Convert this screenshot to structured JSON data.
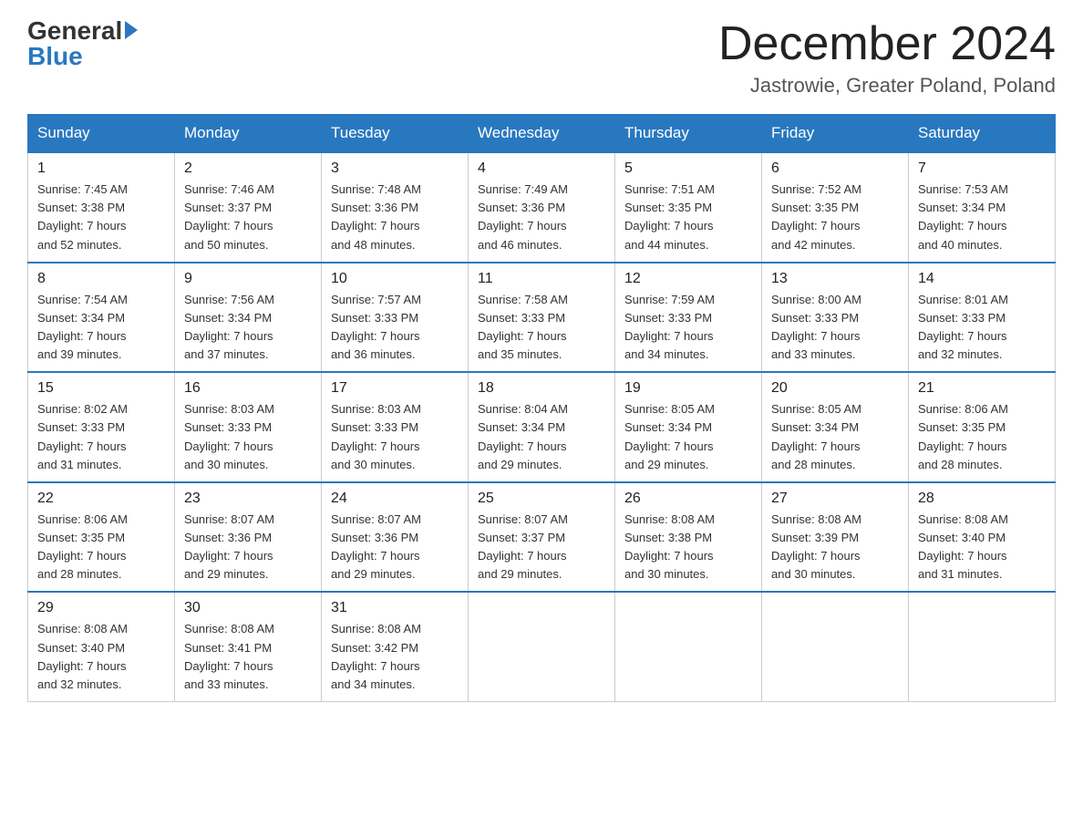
{
  "header": {
    "logo_general": "General",
    "logo_blue": "Blue",
    "month_title": "December 2024",
    "location": "Jastrowie, Greater Poland, Poland"
  },
  "weekdays": [
    "Sunday",
    "Monday",
    "Tuesday",
    "Wednesday",
    "Thursday",
    "Friday",
    "Saturday"
  ],
  "weeks": [
    [
      {
        "day": "1",
        "sunrise": "7:45 AM",
        "sunset": "3:38 PM",
        "daylight": "7 hours and 52 minutes."
      },
      {
        "day": "2",
        "sunrise": "7:46 AM",
        "sunset": "3:37 PM",
        "daylight": "7 hours and 50 minutes."
      },
      {
        "day": "3",
        "sunrise": "7:48 AM",
        "sunset": "3:36 PM",
        "daylight": "7 hours and 48 minutes."
      },
      {
        "day": "4",
        "sunrise": "7:49 AM",
        "sunset": "3:36 PM",
        "daylight": "7 hours and 46 minutes."
      },
      {
        "day": "5",
        "sunrise": "7:51 AM",
        "sunset": "3:35 PM",
        "daylight": "7 hours and 44 minutes."
      },
      {
        "day": "6",
        "sunrise": "7:52 AM",
        "sunset": "3:35 PM",
        "daylight": "7 hours and 42 minutes."
      },
      {
        "day": "7",
        "sunrise": "7:53 AM",
        "sunset": "3:34 PM",
        "daylight": "7 hours and 40 minutes."
      }
    ],
    [
      {
        "day": "8",
        "sunrise": "7:54 AM",
        "sunset": "3:34 PM",
        "daylight": "7 hours and 39 minutes."
      },
      {
        "day": "9",
        "sunrise": "7:56 AM",
        "sunset": "3:34 PM",
        "daylight": "7 hours and 37 minutes."
      },
      {
        "day": "10",
        "sunrise": "7:57 AM",
        "sunset": "3:33 PM",
        "daylight": "7 hours and 36 minutes."
      },
      {
        "day": "11",
        "sunrise": "7:58 AM",
        "sunset": "3:33 PM",
        "daylight": "7 hours and 35 minutes."
      },
      {
        "day": "12",
        "sunrise": "7:59 AM",
        "sunset": "3:33 PM",
        "daylight": "7 hours and 34 minutes."
      },
      {
        "day": "13",
        "sunrise": "8:00 AM",
        "sunset": "3:33 PM",
        "daylight": "7 hours and 33 minutes."
      },
      {
        "day": "14",
        "sunrise": "8:01 AM",
        "sunset": "3:33 PM",
        "daylight": "7 hours and 32 minutes."
      }
    ],
    [
      {
        "day": "15",
        "sunrise": "8:02 AM",
        "sunset": "3:33 PM",
        "daylight": "7 hours and 31 minutes."
      },
      {
        "day": "16",
        "sunrise": "8:03 AM",
        "sunset": "3:33 PM",
        "daylight": "7 hours and 30 minutes."
      },
      {
        "day": "17",
        "sunrise": "8:03 AM",
        "sunset": "3:33 PM",
        "daylight": "7 hours and 30 minutes."
      },
      {
        "day": "18",
        "sunrise": "8:04 AM",
        "sunset": "3:34 PM",
        "daylight": "7 hours and 29 minutes."
      },
      {
        "day": "19",
        "sunrise": "8:05 AM",
        "sunset": "3:34 PM",
        "daylight": "7 hours and 29 minutes."
      },
      {
        "day": "20",
        "sunrise": "8:05 AM",
        "sunset": "3:34 PM",
        "daylight": "7 hours and 28 minutes."
      },
      {
        "day": "21",
        "sunrise": "8:06 AM",
        "sunset": "3:35 PM",
        "daylight": "7 hours and 28 minutes."
      }
    ],
    [
      {
        "day": "22",
        "sunrise": "8:06 AM",
        "sunset": "3:35 PM",
        "daylight": "7 hours and 28 minutes."
      },
      {
        "day": "23",
        "sunrise": "8:07 AM",
        "sunset": "3:36 PM",
        "daylight": "7 hours and 29 minutes."
      },
      {
        "day": "24",
        "sunrise": "8:07 AM",
        "sunset": "3:36 PM",
        "daylight": "7 hours and 29 minutes."
      },
      {
        "day": "25",
        "sunrise": "8:07 AM",
        "sunset": "3:37 PM",
        "daylight": "7 hours and 29 minutes."
      },
      {
        "day": "26",
        "sunrise": "8:08 AM",
        "sunset": "3:38 PM",
        "daylight": "7 hours and 30 minutes."
      },
      {
        "day": "27",
        "sunrise": "8:08 AM",
        "sunset": "3:39 PM",
        "daylight": "7 hours and 30 minutes."
      },
      {
        "day": "28",
        "sunrise": "8:08 AM",
        "sunset": "3:40 PM",
        "daylight": "7 hours and 31 minutes."
      }
    ],
    [
      {
        "day": "29",
        "sunrise": "8:08 AM",
        "sunset": "3:40 PM",
        "daylight": "7 hours and 32 minutes."
      },
      {
        "day": "30",
        "sunrise": "8:08 AM",
        "sunset": "3:41 PM",
        "daylight": "7 hours and 33 minutes."
      },
      {
        "day": "31",
        "sunrise": "8:08 AM",
        "sunset": "3:42 PM",
        "daylight": "7 hours and 34 minutes."
      },
      null,
      null,
      null,
      null
    ]
  ],
  "labels": {
    "sunrise": "Sunrise:",
    "sunset": "Sunset:",
    "daylight": "Daylight:"
  }
}
